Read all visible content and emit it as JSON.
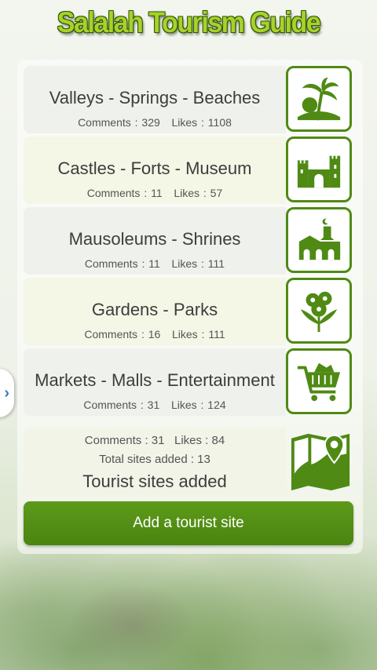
{
  "app": {
    "title": "Salalah Tourism Guide"
  },
  "categories": [
    {
      "name": "Valleys - Springs - Beaches",
      "comments_label": "Comments : 329",
      "likes_label": "Likes : 1108",
      "icon": "palm-tree-icon"
    },
    {
      "name": "Castles - Forts - Museum",
      "comments_label": "Comments : 11",
      "likes_label": "Likes : 57",
      "icon": "castle-icon"
    },
    {
      "name": "Mausoleums - Shrines",
      "comments_label": "Comments : 11",
      "likes_label": "Likes : 111",
      "icon": "shrine-icon"
    },
    {
      "name": "Gardens - Parks",
      "comments_label": "Comments : 16",
      "likes_label": "Likes : 111",
      "icon": "flowers-icon"
    },
    {
      "name": "Markets - Malls - Entertainment",
      "comments_label": "Comments : 31",
      "likes_label": "Likes : 124",
      "icon": "shopping-cart-icon"
    }
  ],
  "tourist_sites": {
    "comments_label": "Comments : 31",
    "likes_label": "Likes : 84",
    "total_label": "Total sites added : 13",
    "title": "Tourist sites added",
    "icon": "map-pin-icon"
  },
  "actions": {
    "add_site_label": "Add a tourist site"
  },
  "side_tab": {
    "glyph": "›"
  },
  "colors": {
    "accent": "#4f8a14",
    "button": "#5d9a1a",
    "title_fill": "#a9d12a"
  }
}
